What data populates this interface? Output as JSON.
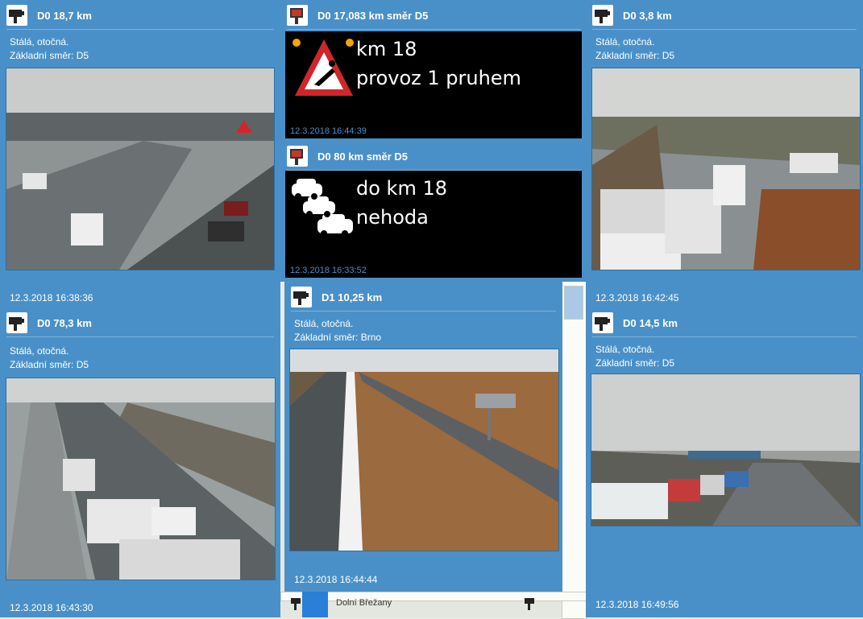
{
  "map": {
    "place_label": "Dolní Břežany"
  },
  "panels": {
    "p1": {
      "title": "D0 18,7 km",
      "type_text": "Stálá, otočná.",
      "direction": "Základní směr: D5",
      "time": "12.3.2018 16:38:36"
    },
    "p2": {
      "title": "D0 17,083 km směr D5",
      "line1": "km 18",
      "line2": "provoz 1 pruhem",
      "time": "12.3.2018 16:44:39"
    },
    "p3": {
      "title": "D0 80 km směr D5",
      "line1": "do km 18",
      "line2": "nehoda",
      "time": "12.3.2018 16:33:52"
    },
    "p4": {
      "title": "D0 3,8 km",
      "type_text": "Stálá, otočná.",
      "direction": "Základní směr: D5",
      "time": "12.3.2018 16:42:45"
    },
    "p5": {
      "title": "D0 78,3 km",
      "type_text": "Stálá, otočná.",
      "direction": "Základní směr: D5",
      "time": "12.3.2018 16:43:30"
    },
    "p6": {
      "title": "D1 10,25 km",
      "type_text": "Stálá, otočná.",
      "direction": "Základní směr: Brno",
      "time": "12.3.2018 16:44:44"
    },
    "p7": {
      "title": "D0 14,5 km",
      "type_text": "Stálá, otočná.",
      "direction": "Základní směr: D5",
      "time": "12.3.2018 16:49:56"
    }
  },
  "icons": {
    "camera": "traffic-camera-icon",
    "vms": "traffic-sign-icon",
    "warning": "warning-triangle-icon",
    "cars": "traffic-jam-icon"
  },
  "colors": {
    "panel": "#4a90c8",
    "vms_bg": "#000000",
    "sign_red": "#d0262b",
    "lamp": "#f5a300"
  }
}
